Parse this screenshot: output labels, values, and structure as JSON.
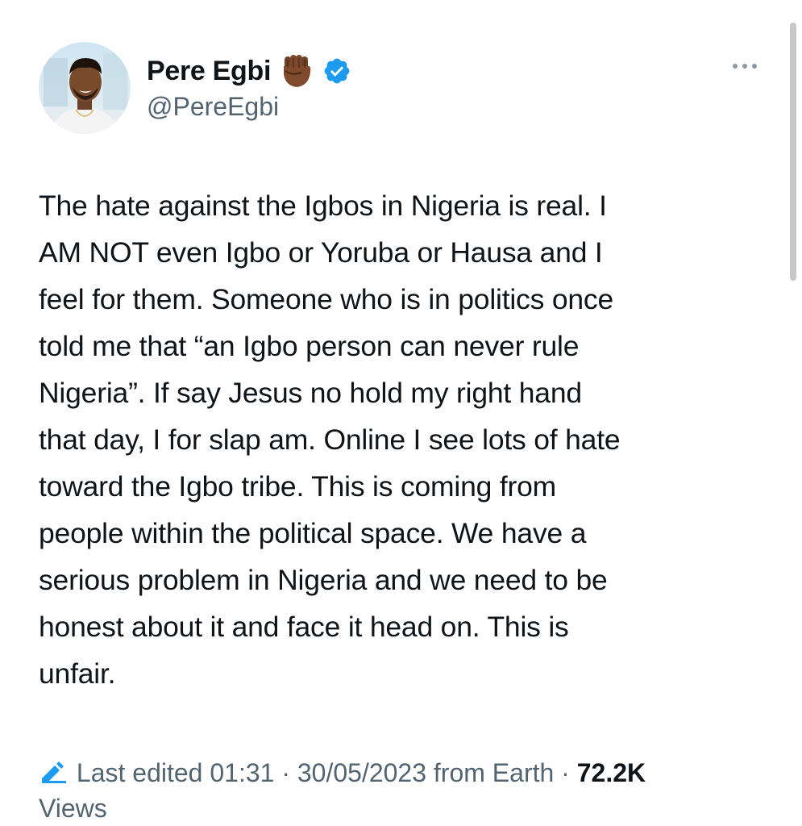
{
  "author": {
    "display_name": "Pere Egbi",
    "handle": "@PereEgbi",
    "emoji_icon": "raised-fist-icon",
    "verified_icon": "verified-badge-icon",
    "verified_color": "#1d9bf0"
  },
  "tweet": {
    "text": "The hate against the Igbos in Nigeria is real. I\nAM NOT even Igbo or Yoruba or Hausa and I\nfeel for them. Someone who is in politics once\ntold me that “an Igbo person can never rule\nNigeria”. If say Jesus no hold my right hand\nthat day, I for slap am.  Online I see lots of hate\ntoward the Igbo tribe.  This is coming from\npeople within the political space. We have a\nserious problem in Nigeria and we need to be\nhonest about it and face it head on. This is\nunfair."
  },
  "meta": {
    "edit_icon": "pencil-icon",
    "edited_label": "Last edited 01:31",
    "separator": " · ",
    "date": "30/05/2023",
    "source": " from Earth",
    "views_count": "72.2K",
    "views_label": "Views"
  },
  "colors": {
    "text": "#0f1419",
    "secondary": "#536471",
    "accent": "#1d9bf0"
  }
}
